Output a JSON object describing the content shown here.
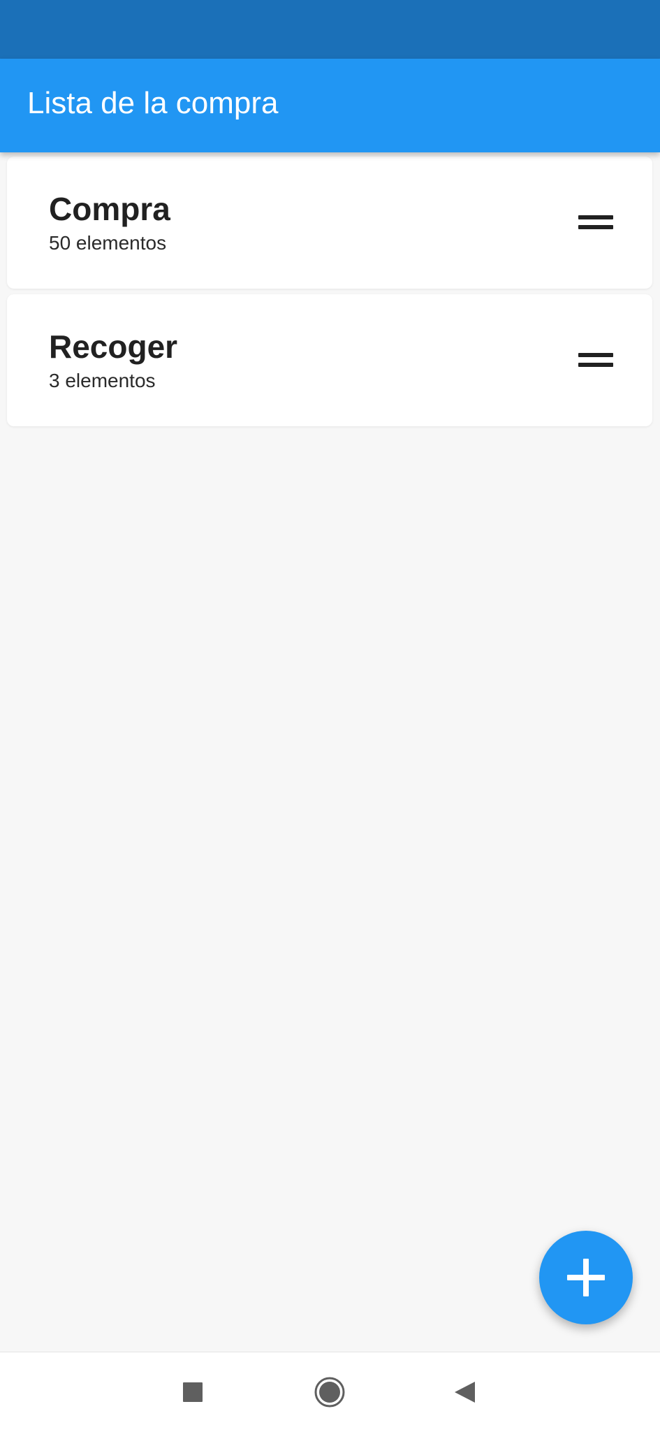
{
  "app_bar": {
    "title": "Lista de la compra"
  },
  "lists": [
    {
      "name": "Compra",
      "count_label": "50 elementos",
      "handle_icon": "drag-handle-icon"
    },
    {
      "name": "Recoger",
      "count_label": "3 elementos",
      "handle_icon": "drag-handle-icon"
    }
  ],
  "fab": {
    "icon": "plus-icon"
  },
  "nav_bar": {
    "buttons": [
      "recents-icon",
      "home-icon",
      "back-icon"
    ]
  },
  "colors": {
    "status_bar": "#1b70b8",
    "primary": "#2196f3",
    "background": "#f7f7f7",
    "card": "#ffffff",
    "text": "#212121"
  }
}
